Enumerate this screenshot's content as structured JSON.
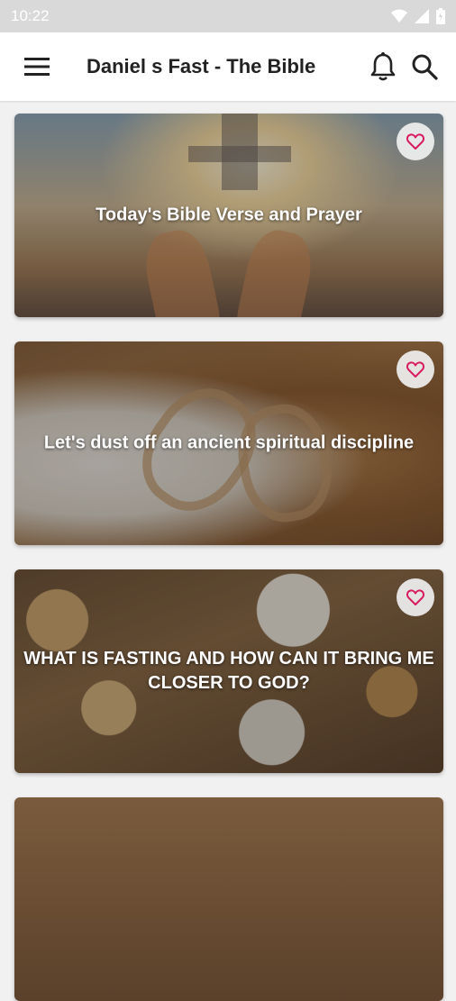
{
  "status_bar": {
    "time": "10:22"
  },
  "app_bar": {
    "title": "Daniel s Fast - The Bible"
  },
  "icons": {
    "menu": "hamburger-menu-icon",
    "notifications": "bell-icon",
    "search": "search-icon",
    "favorite": "heart-outline-icon"
  },
  "colors": {
    "heart": "#d81b60",
    "title_text": "#222222",
    "status_bar_bg": "#d9d9d9"
  },
  "cards": [
    {
      "title": "Today's Bible Verse and Prayer"
    },
    {
      "title": "Let's dust off an ancient spiritual discipline"
    },
    {
      "title": "WHAT IS FASTING AND HOW CAN IT BRING ME CLOSER TO GOD?"
    },
    {
      "title": ""
    }
  ]
}
